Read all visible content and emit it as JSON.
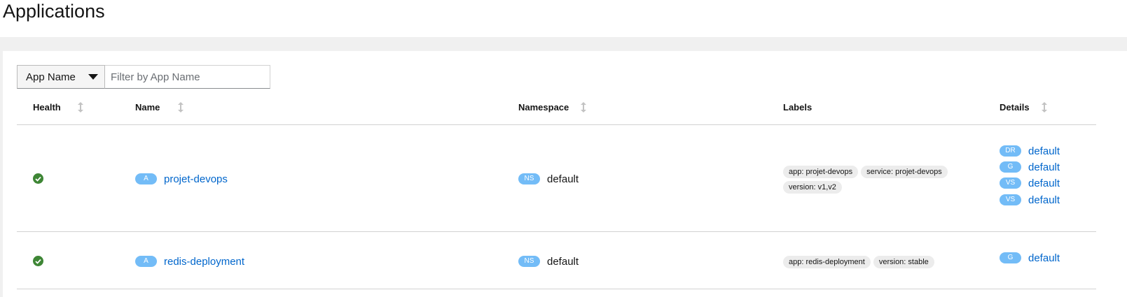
{
  "page": {
    "title": "Applications"
  },
  "filter": {
    "type_label": "App Name",
    "placeholder": "Filter by App Name"
  },
  "table": {
    "columns": [
      "Health",
      "Name",
      "Namespace",
      "Labels",
      "Details"
    ],
    "rows": [
      {
        "health": "healthy",
        "name_badge": "A",
        "name": "projet-devops",
        "ns_badge": "NS",
        "namespace": "default",
        "labels": [
          "app: projet-devops",
          "service: projet-devops",
          "version: v1,v2"
        ],
        "details": [
          {
            "badge": "DR",
            "link": "default"
          },
          {
            "badge": "G",
            "link": "default"
          },
          {
            "badge": "VS",
            "link": "default"
          },
          {
            "badge": "VS",
            "link": "default"
          }
        ]
      },
      {
        "health": "healthy",
        "name_badge": "A",
        "name": "redis-deployment",
        "ns_badge": "NS",
        "namespace": "default",
        "labels": [
          "app: redis-deployment",
          "version: stable"
        ],
        "details": [
          {
            "badge": "G",
            "link": "default"
          }
        ]
      }
    ]
  },
  "colors": {
    "healthy": "#3e8635",
    "badge": "#73bcf7",
    "link": "#0066cc"
  }
}
